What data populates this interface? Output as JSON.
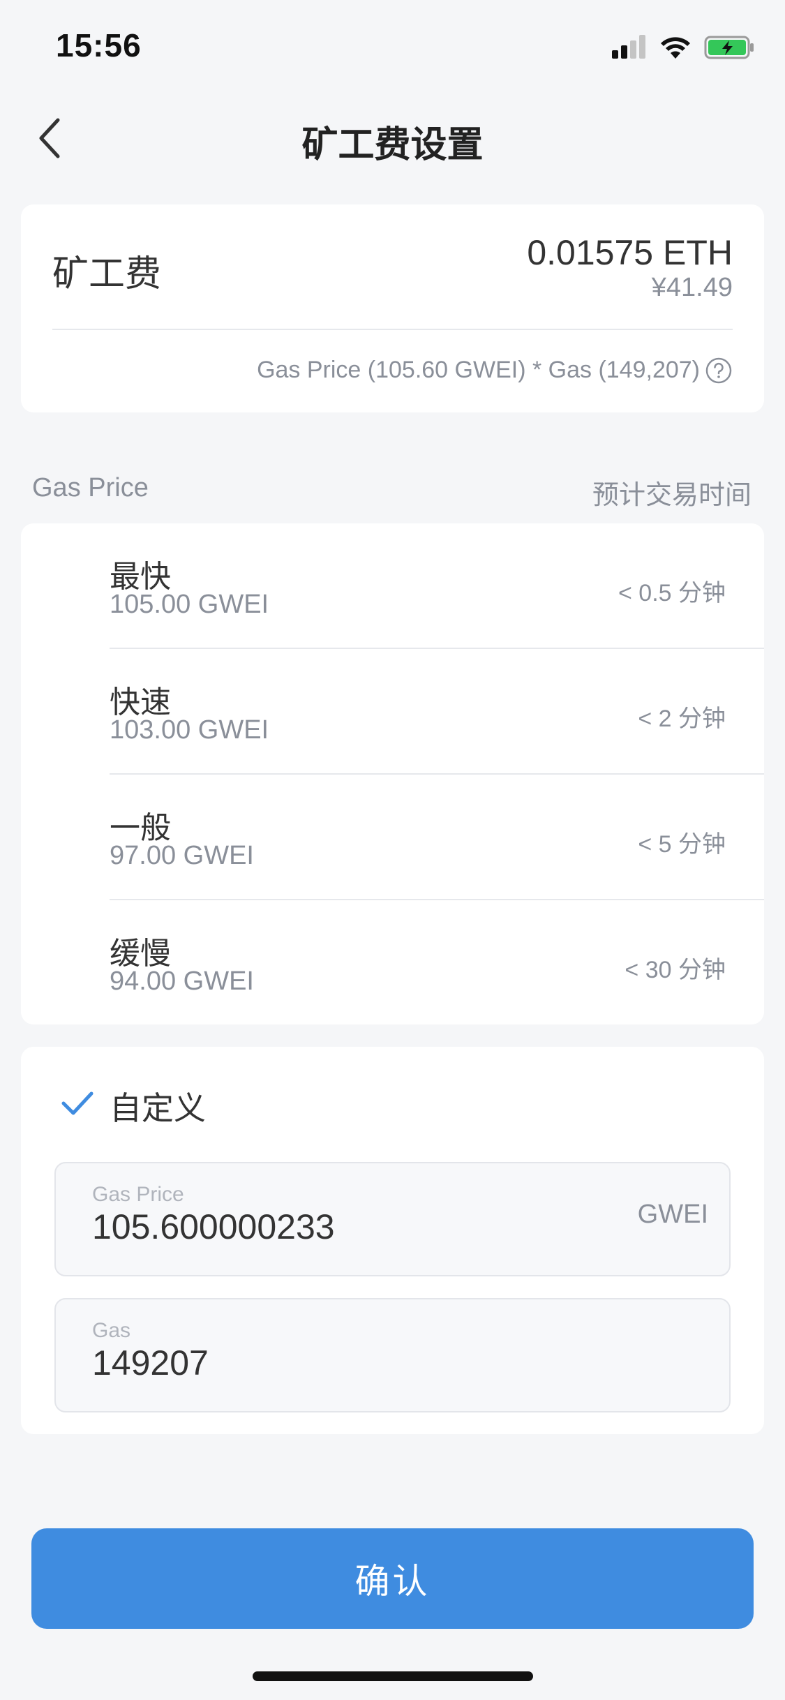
{
  "status_bar": {
    "time": "15:56"
  },
  "header": {
    "title": "矿工费设置"
  },
  "fee": {
    "label": "矿工费",
    "amount": "0.01575 ETH",
    "fiat": "¥41.49",
    "formula": "Gas Price (105.60 GWEI) * Gas (149,207)"
  },
  "section": {
    "left": "Gas Price",
    "right": "预计交易时间"
  },
  "speeds": [
    {
      "name": "最快",
      "gwei": "105.00 GWEI",
      "time": "< 0.5 分钟"
    },
    {
      "name": "快速",
      "gwei": "103.00 GWEI",
      "time": "< 2 分钟"
    },
    {
      "name": "一般",
      "gwei": "97.00 GWEI",
      "time": "< 5 分钟"
    },
    {
      "name": "缓慢",
      "gwei": "94.00 GWEI",
      "time": "< 30 分钟"
    }
  ],
  "custom": {
    "label": "自定义",
    "selected": true,
    "gas_price": {
      "label": "Gas Price",
      "value": "105.600000233",
      "unit": "GWEI"
    },
    "gas": {
      "label": "Gas",
      "value": "149207"
    }
  },
  "confirm_label": "确认",
  "colors": {
    "accent": "#3f8ce0",
    "background": "#f5f6f8"
  }
}
